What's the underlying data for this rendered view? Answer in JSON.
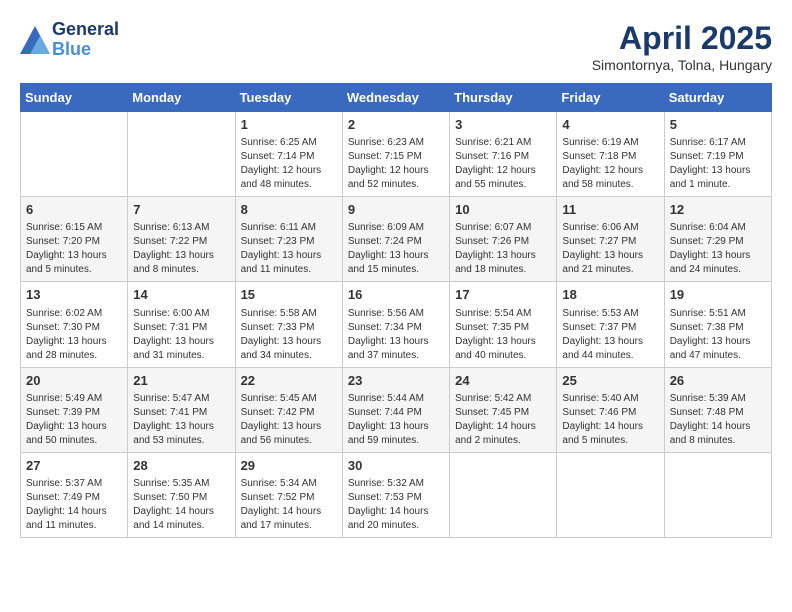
{
  "header": {
    "logo_line1": "General",
    "logo_line2": "Blue",
    "month_title": "April 2025",
    "subtitle": "Simontornya, Tolna, Hungary"
  },
  "weekdays": [
    "Sunday",
    "Monday",
    "Tuesday",
    "Wednesday",
    "Thursday",
    "Friday",
    "Saturday"
  ],
  "weeks": [
    [
      {
        "day": "",
        "info": ""
      },
      {
        "day": "",
        "info": ""
      },
      {
        "day": "1",
        "info": "Sunrise: 6:25 AM\nSunset: 7:14 PM\nDaylight: 12 hours\nand 48 minutes."
      },
      {
        "day": "2",
        "info": "Sunrise: 6:23 AM\nSunset: 7:15 PM\nDaylight: 12 hours\nand 52 minutes."
      },
      {
        "day": "3",
        "info": "Sunrise: 6:21 AM\nSunset: 7:16 PM\nDaylight: 12 hours\nand 55 minutes."
      },
      {
        "day": "4",
        "info": "Sunrise: 6:19 AM\nSunset: 7:18 PM\nDaylight: 12 hours\nand 58 minutes."
      },
      {
        "day": "5",
        "info": "Sunrise: 6:17 AM\nSunset: 7:19 PM\nDaylight: 13 hours\nand 1 minute."
      }
    ],
    [
      {
        "day": "6",
        "info": "Sunrise: 6:15 AM\nSunset: 7:20 PM\nDaylight: 13 hours\nand 5 minutes."
      },
      {
        "day": "7",
        "info": "Sunrise: 6:13 AM\nSunset: 7:22 PM\nDaylight: 13 hours\nand 8 minutes."
      },
      {
        "day": "8",
        "info": "Sunrise: 6:11 AM\nSunset: 7:23 PM\nDaylight: 13 hours\nand 11 minutes."
      },
      {
        "day": "9",
        "info": "Sunrise: 6:09 AM\nSunset: 7:24 PM\nDaylight: 13 hours\nand 15 minutes."
      },
      {
        "day": "10",
        "info": "Sunrise: 6:07 AM\nSunset: 7:26 PM\nDaylight: 13 hours\nand 18 minutes."
      },
      {
        "day": "11",
        "info": "Sunrise: 6:06 AM\nSunset: 7:27 PM\nDaylight: 13 hours\nand 21 minutes."
      },
      {
        "day": "12",
        "info": "Sunrise: 6:04 AM\nSunset: 7:29 PM\nDaylight: 13 hours\nand 24 minutes."
      }
    ],
    [
      {
        "day": "13",
        "info": "Sunrise: 6:02 AM\nSunset: 7:30 PM\nDaylight: 13 hours\nand 28 minutes."
      },
      {
        "day": "14",
        "info": "Sunrise: 6:00 AM\nSunset: 7:31 PM\nDaylight: 13 hours\nand 31 minutes."
      },
      {
        "day": "15",
        "info": "Sunrise: 5:58 AM\nSunset: 7:33 PM\nDaylight: 13 hours\nand 34 minutes."
      },
      {
        "day": "16",
        "info": "Sunrise: 5:56 AM\nSunset: 7:34 PM\nDaylight: 13 hours\nand 37 minutes."
      },
      {
        "day": "17",
        "info": "Sunrise: 5:54 AM\nSunset: 7:35 PM\nDaylight: 13 hours\nand 40 minutes."
      },
      {
        "day": "18",
        "info": "Sunrise: 5:53 AM\nSunset: 7:37 PM\nDaylight: 13 hours\nand 44 minutes."
      },
      {
        "day": "19",
        "info": "Sunrise: 5:51 AM\nSunset: 7:38 PM\nDaylight: 13 hours\nand 47 minutes."
      }
    ],
    [
      {
        "day": "20",
        "info": "Sunrise: 5:49 AM\nSunset: 7:39 PM\nDaylight: 13 hours\nand 50 minutes."
      },
      {
        "day": "21",
        "info": "Sunrise: 5:47 AM\nSunset: 7:41 PM\nDaylight: 13 hours\nand 53 minutes."
      },
      {
        "day": "22",
        "info": "Sunrise: 5:45 AM\nSunset: 7:42 PM\nDaylight: 13 hours\nand 56 minutes."
      },
      {
        "day": "23",
        "info": "Sunrise: 5:44 AM\nSunset: 7:44 PM\nDaylight: 13 hours\nand 59 minutes."
      },
      {
        "day": "24",
        "info": "Sunrise: 5:42 AM\nSunset: 7:45 PM\nDaylight: 14 hours\nand 2 minutes."
      },
      {
        "day": "25",
        "info": "Sunrise: 5:40 AM\nSunset: 7:46 PM\nDaylight: 14 hours\nand 5 minutes."
      },
      {
        "day": "26",
        "info": "Sunrise: 5:39 AM\nSunset: 7:48 PM\nDaylight: 14 hours\nand 8 minutes."
      }
    ],
    [
      {
        "day": "27",
        "info": "Sunrise: 5:37 AM\nSunset: 7:49 PM\nDaylight: 14 hours\nand 11 minutes."
      },
      {
        "day": "28",
        "info": "Sunrise: 5:35 AM\nSunset: 7:50 PM\nDaylight: 14 hours\nand 14 minutes."
      },
      {
        "day": "29",
        "info": "Sunrise: 5:34 AM\nSunset: 7:52 PM\nDaylight: 14 hours\nand 17 minutes."
      },
      {
        "day": "30",
        "info": "Sunrise: 5:32 AM\nSunset: 7:53 PM\nDaylight: 14 hours\nand 20 minutes."
      },
      {
        "day": "",
        "info": ""
      },
      {
        "day": "",
        "info": ""
      },
      {
        "day": "",
        "info": ""
      }
    ]
  ]
}
